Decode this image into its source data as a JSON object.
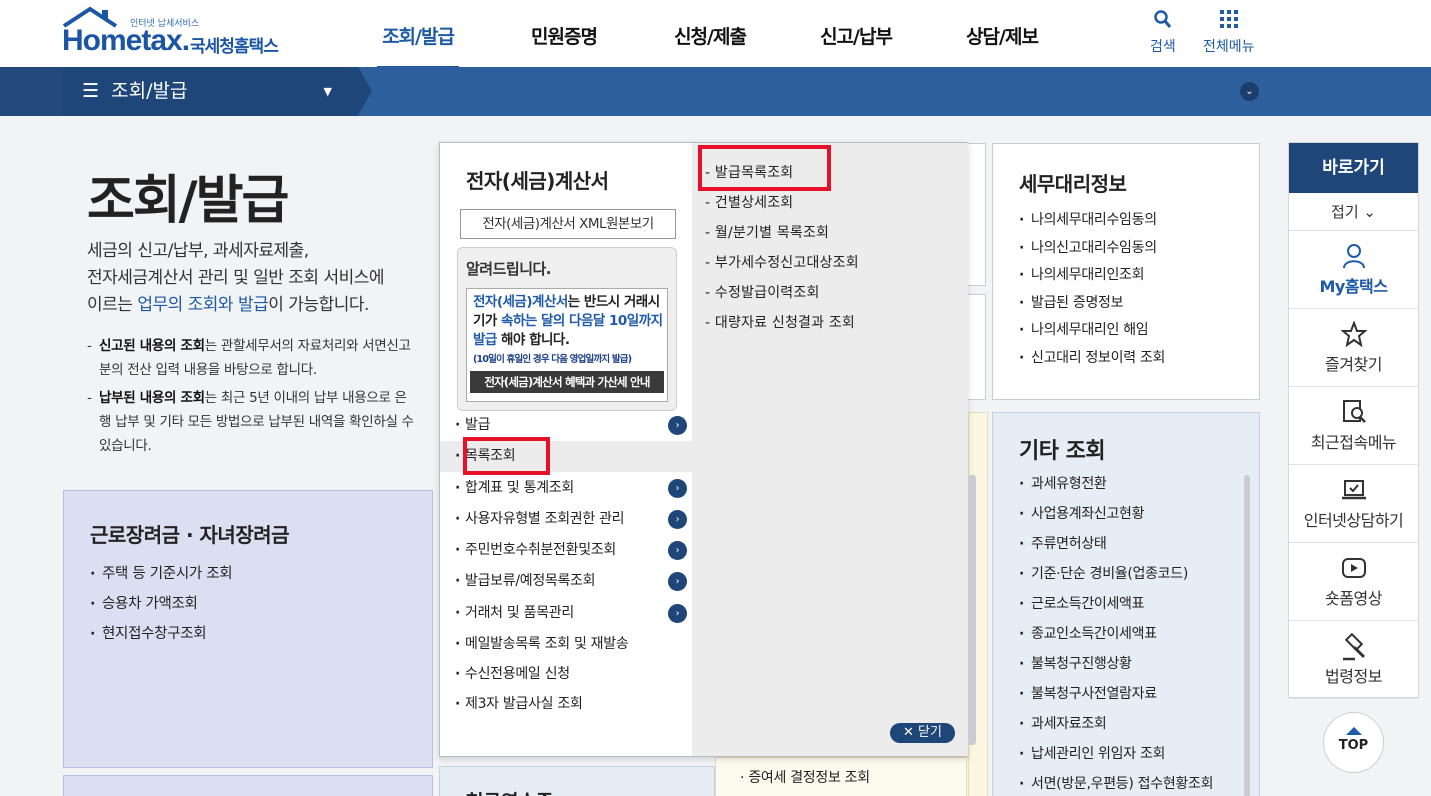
{
  "header": {
    "logo_tagline": "인터넷 납세서비스",
    "logo_word": "Hometax.",
    "logo_kr": "국세청홈택스",
    "gnb": [
      {
        "label": "조회/발급"
      },
      {
        "label": "민원증명"
      },
      {
        "label": "신청/제출"
      },
      {
        "label": "신고/납부"
      },
      {
        "label": "상담/제보"
      }
    ],
    "search_label": "검색",
    "allmenu_label": "전체메뉴"
  },
  "subbar": {
    "current": "조회/발급"
  },
  "intro": {
    "title": "조회/발급",
    "desc_1": "세금의 신고/납부, 과세자료제출,",
    "desc_2": "전자세금계산서 관리 및 일반 조회 서비스에",
    "desc_3a": "이르는 ",
    "desc_3_link": "업무의 조회와 발급",
    "desc_3b": "이 가능합니다.",
    "notes": [
      {
        "bold": "신고된 내용의 조회",
        "text": "는 관할세무서의 자료처리와 서면신고분의 전산 입력 내용을 바탕으로 합니다."
      },
      {
        "bold": "납부된 내용의 조회",
        "text": "는 최근 5년 이내의 납부 내용으로 은행 납부 및 기타 모든 방법으로 납부된 내역을 확인하실 수 있습니다."
      }
    ]
  },
  "card_earned": {
    "title": "근로장려금 · 자녀장려금",
    "items": [
      "주택 등 기준시가 조회",
      "승용차 가액조회",
      "현지접수창구조회"
    ]
  },
  "card_tax_agent": {
    "title": "세무대리정보",
    "items": [
      "나의세무대리수임동의",
      "나의신고대리수임동의",
      "나의세무대리인조회",
      "발급된 증명정보",
      "나의세무대리인 해임",
      "신고대리 정보이력 조회"
    ]
  },
  "card_etc": {
    "title": "기타 조회",
    "items": [
      "과세유형전환",
      "사업용계좌신고현황",
      "주류면허상태",
      "기준·단순 경비율(업종코드)",
      "근로소득간이세액표",
      "종교인소득간이세액표",
      "불복청구진행상황",
      "불복청구사전열람자료",
      "과세자료조회",
      "납세관리인 위임자 조회",
      "서면(방문,우편등) 접수현황조회"
    ]
  },
  "under": {
    "gift_tax": "증여세 결정정보 조회",
    "cash_receipt": "현금영수증"
  },
  "mega": {
    "title": "전자(세금)계산서",
    "xml_button": "전자(세금)계산서 XML원본보기",
    "notice_title": "알려드립니다.",
    "notice_line1a": "전자(세금)계산서",
    "notice_line1b": "는 반드시 거래시기가 ",
    "notice_line1c": "속하는 달의 다음달 10일까지 발급",
    "notice_line1d": " 해야 합니다.",
    "notice_line2": "(10일이 휴일인 경우 다음 영업일까지 발급)",
    "notice_line3": "전자(세금)계산서 혜택과 가산세 안내",
    "lv1": [
      {
        "label": "발급",
        "has_arrow": true
      },
      {
        "label": "목록조회",
        "has_arrow": false
      },
      {
        "label": "합계표 및 통계조회",
        "has_arrow": true
      },
      {
        "label": "사용자유형별 조회권한 관리",
        "has_arrow": true
      },
      {
        "label": "주민번호수취분전환및조회",
        "has_arrow": true
      },
      {
        "label": "발급보류/예정목록조회",
        "has_arrow": true
      },
      {
        "label": "거래처 및 품목관리",
        "has_arrow": true
      },
      {
        "label": "메일발송목록 조회 및 재발송",
        "has_arrow": false
      },
      {
        "label": "수신전용메일 신청",
        "has_arrow": false
      },
      {
        "label": "제3자 발급사실 조회",
        "has_arrow": false
      }
    ],
    "lv2": [
      "발급목록조회",
      "건별상세조회",
      "월/분기별 목록조회",
      "부가세수정신고대상조회",
      "수정발급이력조회",
      "대량자료 신청결과 조회"
    ],
    "close_label": "닫기"
  },
  "quick": {
    "title": "바로가기",
    "fold": "접기",
    "items": [
      "My홈택스",
      "즐겨찾기",
      "최근접속메뉴",
      "인터넷상담하기",
      "숏폼영상",
      "법령정보"
    ],
    "top": "TOP"
  }
}
